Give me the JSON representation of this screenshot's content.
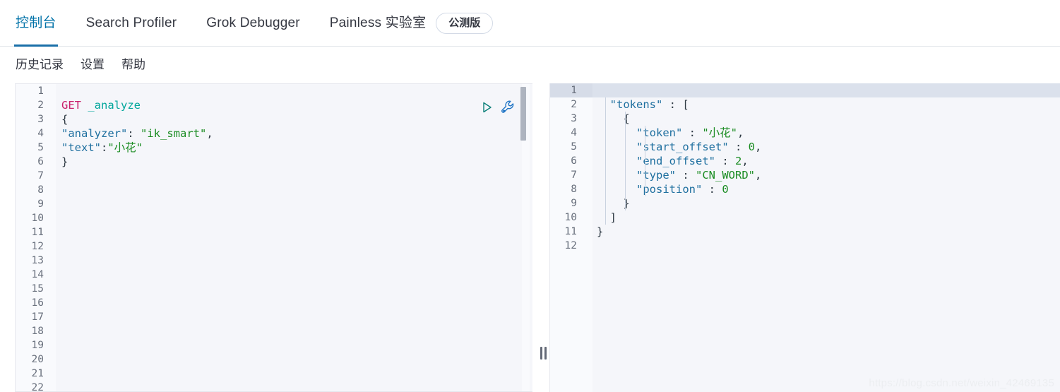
{
  "tabs": [
    {
      "label": "控制台",
      "active": true
    },
    {
      "label": "Search Profiler",
      "active": false
    },
    {
      "label": "Grok Debugger",
      "active": false
    },
    {
      "label": "Painless 实验室",
      "active": false
    }
  ],
  "beta_badge": "公测版",
  "subnav": [
    {
      "label": "历史记录"
    },
    {
      "label": "设置"
    },
    {
      "label": "帮助"
    }
  ],
  "actions": {
    "run_icon": "play-icon",
    "wrench_icon": "wrench-icon"
  },
  "editor": {
    "total_lines": 22,
    "gutter": [
      {
        "n": "1",
        "fold": ""
      },
      {
        "n": "2",
        "fold": ""
      },
      {
        "n": "3",
        "fold": "▾"
      },
      {
        "n": "4",
        "fold": ""
      },
      {
        "n": "5",
        "fold": ""
      },
      {
        "n": "6",
        "fold": "▴"
      },
      {
        "n": "7",
        "fold": ""
      },
      {
        "n": "8",
        "fold": ""
      },
      {
        "n": "9",
        "fold": ""
      },
      {
        "n": "10",
        "fold": ""
      },
      {
        "n": "11",
        "fold": ""
      },
      {
        "n": "12",
        "fold": ""
      },
      {
        "n": "13",
        "fold": ""
      },
      {
        "n": "14",
        "fold": ""
      },
      {
        "n": "15",
        "fold": ""
      },
      {
        "n": "16",
        "fold": ""
      },
      {
        "n": "17",
        "fold": ""
      },
      {
        "n": "18",
        "fold": ""
      },
      {
        "n": "19",
        "fold": ""
      },
      {
        "n": "20",
        "fold": ""
      },
      {
        "n": "21",
        "fold": ""
      },
      {
        "n": "22",
        "fold": ""
      }
    ],
    "lines": [
      {
        "n": 1,
        "text": ""
      },
      {
        "n": 2,
        "text": "GET _analyze",
        "tokens": [
          {
            "t": "GET",
            "c": "tok-method"
          },
          {
            "t": " ",
            "c": "tok-punct"
          },
          {
            "t": "_analyze",
            "c": "tok-url"
          }
        ]
      },
      {
        "n": 3,
        "text": "{",
        "tokens": [
          {
            "t": "{",
            "c": "tok-brace"
          }
        ]
      },
      {
        "n": 4,
        "text": "\"analyzer\": \"ik_smart\",",
        "tokens": [
          {
            "t": "\"analyzer\"",
            "c": "tok-key"
          },
          {
            "t": ": ",
            "c": "tok-punct"
          },
          {
            "t": "\"ik_smart\"",
            "c": "tok-str"
          },
          {
            "t": ",",
            "c": "tok-punct"
          }
        ]
      },
      {
        "n": 5,
        "text": "\"text\":\"小花\"",
        "tokens": [
          {
            "t": "\"text\"",
            "c": "tok-key"
          },
          {
            "t": ":",
            "c": "tok-punct"
          },
          {
            "t": "\"小花\"",
            "c": "tok-str"
          }
        ]
      },
      {
        "n": 6,
        "text": "}",
        "tokens": [
          {
            "t": "}",
            "c": "tok-brace"
          }
        ]
      }
    ]
  },
  "results": {
    "total_lines": 12,
    "active_line": 1,
    "gutter": [
      {
        "n": "1",
        "fold": "▾"
      },
      {
        "n": "2",
        "fold": "▾"
      },
      {
        "n": "3",
        "fold": "▾"
      },
      {
        "n": "4",
        "fold": ""
      },
      {
        "n": "5",
        "fold": ""
      },
      {
        "n": "6",
        "fold": ""
      },
      {
        "n": "7",
        "fold": ""
      },
      {
        "n": "8",
        "fold": ""
      },
      {
        "n": "9",
        "fold": "▴"
      },
      {
        "n": "10",
        "fold": "▴"
      },
      {
        "n": "11",
        "fold": "▴"
      },
      {
        "n": "12",
        "fold": ""
      }
    ],
    "lines": [
      {
        "n": 1,
        "text": "{",
        "tokens": [
          {
            "t": "{",
            "c": "tok-brace"
          }
        ]
      },
      {
        "n": 2,
        "text": "  \"tokens\" : [",
        "tokens": [
          {
            "t": "  ",
            "c": "tok-punct"
          },
          {
            "t": "\"tokens\"",
            "c": "tok-key"
          },
          {
            "t": " : ",
            "c": "tok-punct"
          },
          {
            "t": "[",
            "c": "tok-brace"
          }
        ]
      },
      {
        "n": 3,
        "text": "    {",
        "tokens": [
          {
            "t": "    ",
            "c": "tok-punct"
          },
          {
            "t": "{",
            "c": "tok-brace"
          }
        ]
      },
      {
        "n": 4,
        "text": "      \"token\" : \"小花\",",
        "tokens": [
          {
            "t": "      ",
            "c": "tok-punct"
          },
          {
            "t": "\"token\"",
            "c": "tok-key"
          },
          {
            "t": " : ",
            "c": "tok-punct"
          },
          {
            "t": "\"小花\"",
            "c": "tok-str"
          },
          {
            "t": ",",
            "c": "tok-punct"
          }
        ]
      },
      {
        "n": 5,
        "text": "      \"start_offset\" : 0,",
        "tokens": [
          {
            "t": "      ",
            "c": "tok-punct"
          },
          {
            "t": "\"start_offset\"",
            "c": "tok-key"
          },
          {
            "t": " : ",
            "c": "tok-punct"
          },
          {
            "t": "0",
            "c": "tok-num"
          },
          {
            "t": ",",
            "c": "tok-punct"
          }
        ]
      },
      {
        "n": 6,
        "text": "      \"end_offset\" : 2,",
        "tokens": [
          {
            "t": "      ",
            "c": "tok-punct"
          },
          {
            "t": "\"end_offset\"",
            "c": "tok-key"
          },
          {
            "t": " : ",
            "c": "tok-punct"
          },
          {
            "t": "2",
            "c": "tok-num"
          },
          {
            "t": ",",
            "c": "tok-punct"
          }
        ]
      },
      {
        "n": 7,
        "text": "      \"type\" : \"CN_WORD\",",
        "tokens": [
          {
            "t": "      ",
            "c": "tok-punct"
          },
          {
            "t": "\"type\"",
            "c": "tok-key"
          },
          {
            "t": " : ",
            "c": "tok-punct"
          },
          {
            "t": "\"CN_WORD\"",
            "c": "tok-str"
          },
          {
            "t": ",",
            "c": "tok-punct"
          }
        ]
      },
      {
        "n": 8,
        "text": "      \"position\" : 0",
        "tokens": [
          {
            "t": "      ",
            "c": "tok-punct"
          },
          {
            "t": "\"position\"",
            "c": "tok-key"
          },
          {
            "t": " : ",
            "c": "tok-punct"
          },
          {
            "t": "0",
            "c": "tok-num"
          }
        ]
      },
      {
        "n": 9,
        "text": "    }",
        "tokens": [
          {
            "t": "    ",
            "c": "tok-punct"
          },
          {
            "t": "}",
            "c": "tok-brace"
          }
        ]
      },
      {
        "n": 10,
        "text": "  ]",
        "tokens": [
          {
            "t": "  ",
            "c": "tok-punct"
          },
          {
            "t": "]",
            "c": "tok-brace"
          }
        ]
      },
      {
        "n": 11,
        "text": "}",
        "tokens": [
          {
            "t": "}",
            "c": "tok-brace"
          }
        ]
      },
      {
        "n": 12,
        "text": ""
      }
    ]
  },
  "watermark": "https://blog.csdn.net/weixin_42469135",
  "colors": {
    "accent": "#0072a8",
    "tab_underline": "#1a6fa8",
    "method": "#c9206b",
    "url": "#00a69b",
    "key": "#1e6f9f",
    "string": "#1a8c22",
    "active_line": "#dbe1ec",
    "editor_bg": "#f5f6fa",
    "gutter_bg": "#f9fafd"
  }
}
